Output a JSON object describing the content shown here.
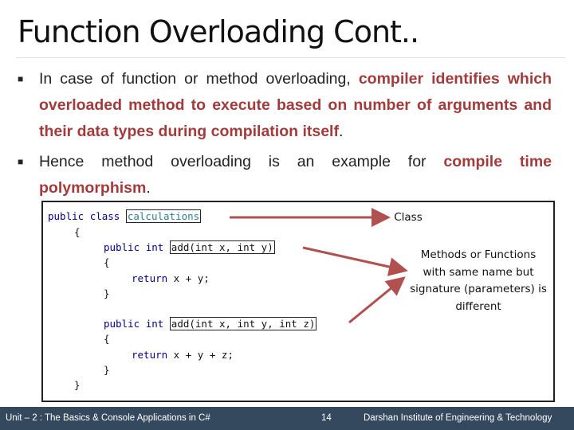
{
  "title": "Function Overloading Cont..",
  "bullets": [
    {
      "pre": "In case of function or method overloading, ",
      "hl": "compiler identifies which overloaded method to execute based on number of arguments and their data types during compilation itself",
      "post": "."
    },
    {
      "pre": "Hence method overloading is an example for ",
      "hl": "compile time polymorphism",
      "post": "."
    }
  ],
  "code": {
    "kw_public": "public",
    "kw_class": "class",
    "class_name": "calculations",
    "kw_int": "int",
    "kw_return": "return",
    "open": "{",
    "close": "}",
    "sig1": "add(int x, int y)",
    "sig2": "add(int x, int y, int z)",
    "ret1": " x + y;",
    "ret2": " x + y + z;"
  },
  "annotations": {
    "class_label": "Class",
    "methods_label": "Methods or Functions with same name but signature (parameters) is different"
  },
  "colors": {
    "arrow": "#b0504f",
    "highlight": "#a23b3b",
    "footer": "#34495e"
  },
  "footer": {
    "unit": "Unit – 2 : The Basics & Console Applications in C#",
    "page": "14",
    "institute": "Darshan Institute of Engineering & Technology"
  }
}
